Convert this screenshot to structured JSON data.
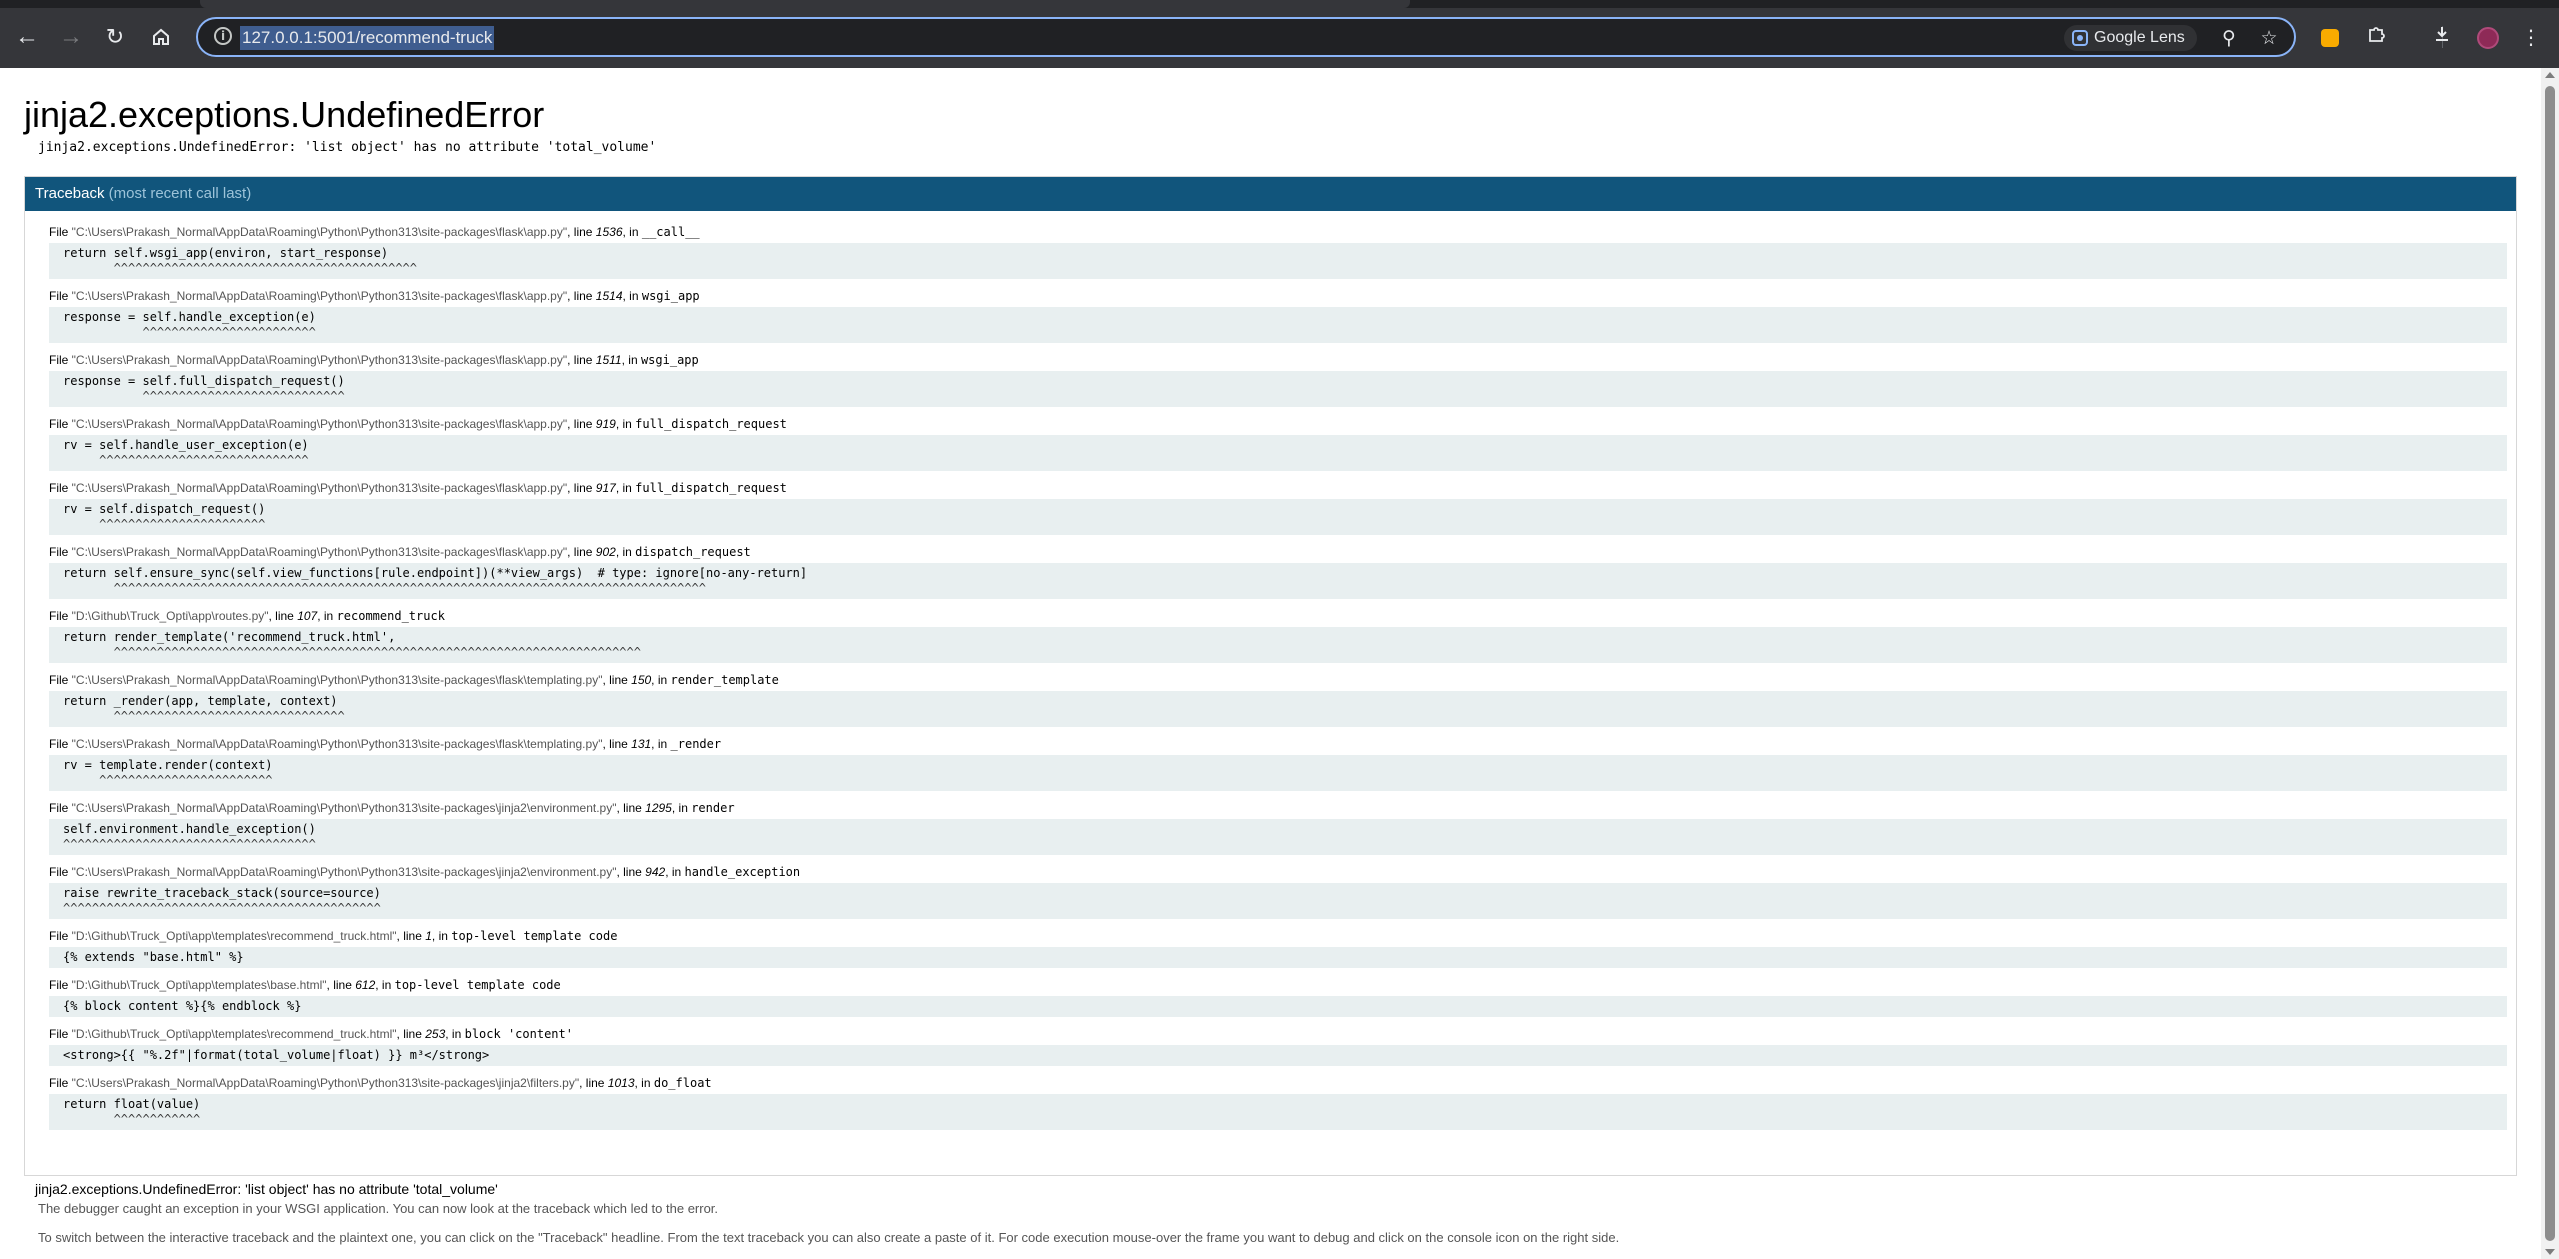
{
  "browser": {
    "url": "127.0.0.1:5001/recommend-truck",
    "lens_label": "Google Lens",
    "icons": [
      "back-icon",
      "forward-icon",
      "reload-icon",
      "home-icon",
      "info-icon",
      "google-lens-icon",
      "zoom-icon",
      "bookmark-star-icon",
      "extension-icon",
      "extensions-puzzle-icon",
      "downloads-icon",
      "profile-avatar",
      "more-menu-icon"
    ]
  },
  "error": {
    "title": "jinja2.exceptions.UndefinedError",
    "message": "jinja2.exceptions.UndefinedError: 'list object' has no attribute 'total_volume'"
  },
  "traceback": {
    "header": "Traceback",
    "header_sub": "(most recent call last)",
    "frames": [
      {
        "file": "\"C:\\Users\\Prakash_Normal\\AppData\\Roaming\\Python\\Python313\\site-packages\\flask\\app.py\"",
        "line": "1536",
        "func": "__call__",
        "code": "return self.wsgi_app(environ, start_response)",
        "caret": "       ^^^^^^^^^^^^^^^^^^^^^^^^^^^^^^^^^^^^^^^^^^"
      },
      {
        "file": "\"C:\\Users\\Prakash_Normal\\AppData\\Roaming\\Python\\Python313\\site-packages\\flask\\app.py\"",
        "line": "1514",
        "func": "wsgi_app",
        "code": "response = self.handle_exception(e)",
        "caret": "           ^^^^^^^^^^^^^^^^^^^^^^^^"
      },
      {
        "file": "\"C:\\Users\\Prakash_Normal\\AppData\\Roaming\\Python\\Python313\\site-packages\\flask\\app.py\"",
        "line": "1511",
        "func": "wsgi_app",
        "code": "response = self.full_dispatch_request()",
        "caret": "           ^^^^^^^^^^^^^^^^^^^^^^^^^^^^"
      },
      {
        "file": "\"C:\\Users\\Prakash_Normal\\AppData\\Roaming\\Python\\Python313\\site-packages\\flask\\app.py\"",
        "line": "919",
        "func": "full_dispatch_request",
        "code": "rv = self.handle_user_exception(e)",
        "caret": "     ^^^^^^^^^^^^^^^^^^^^^^^^^^^^^"
      },
      {
        "file": "\"C:\\Users\\Prakash_Normal\\AppData\\Roaming\\Python\\Python313\\site-packages\\flask\\app.py\"",
        "line": "917",
        "func": "full_dispatch_request",
        "code": "rv = self.dispatch_request()",
        "caret": "     ^^^^^^^^^^^^^^^^^^^^^^^"
      },
      {
        "file": "\"C:\\Users\\Prakash_Normal\\AppData\\Roaming\\Python\\Python313\\site-packages\\flask\\app.py\"",
        "line": "902",
        "func": "dispatch_request",
        "code": "return self.ensure_sync(self.view_functions[rule.endpoint])(**view_args)  # type: ignore[no-any-return]",
        "caret": "       ^^^^^^^^^^^^^^^^^^^^^^^^^^^^^^^^^^^^^^^^^^^^^^^^^^^^^^^^^^^^^^^^^^^^^^^^^^^^^^^^^^"
      },
      {
        "file": "\"D:\\Github\\Truck_Opti\\app\\routes.py\"",
        "line": "107",
        "func": "recommend_truck",
        "code": "return render_template('recommend_truck.html',",
        "caret": "       ^^^^^^^^^^^^^^^^^^^^^^^^^^^^^^^^^^^^^^^^^^^^^^^^^^^^^^^^^^^^^^^^^^^^^^^^^"
      },
      {
        "file": "\"C:\\Users\\Prakash_Normal\\AppData\\Roaming\\Python\\Python313\\site-packages\\flask\\templating.py\"",
        "line": "150",
        "func": "render_template",
        "code": "return _render(app, template, context)",
        "caret": "       ^^^^^^^^^^^^^^^^^^^^^^^^^^^^^^^^"
      },
      {
        "file": "\"C:\\Users\\Prakash_Normal\\AppData\\Roaming\\Python\\Python313\\site-packages\\flask\\templating.py\"",
        "line": "131",
        "func": "_render",
        "code": "rv = template.render(context)",
        "caret": "     ^^^^^^^^^^^^^^^^^^^^^^^^"
      },
      {
        "file": "\"C:\\Users\\Prakash_Normal\\AppData\\Roaming\\Python\\Python313\\site-packages\\jinja2\\environment.py\"",
        "line": "1295",
        "func": "render",
        "code": "self.environment.handle_exception()",
        "caret": "^^^^^^^^^^^^^^^^^^^^^^^^^^^^^^^^^^^"
      },
      {
        "file": "\"C:\\Users\\Prakash_Normal\\AppData\\Roaming\\Python\\Python313\\site-packages\\jinja2\\environment.py\"",
        "line": "942",
        "func": "handle_exception",
        "code": "raise rewrite_traceback_stack(source=source)",
        "caret": "^^^^^^^^^^^^^^^^^^^^^^^^^^^^^^^^^^^^^^^^^^^^"
      },
      {
        "file": "\"D:\\Github\\Truck_Opti\\app\\templates\\recommend_truck.html\"",
        "line": "1",
        "func": "top-level template code",
        "code": "{% extends \"base.html\" %}",
        "caret": ""
      },
      {
        "file": "\"D:\\Github\\Truck_Opti\\app\\templates\\base.html\"",
        "line": "612",
        "func": "top-level template code",
        "code": "{% block content %}{% endblock %}",
        "caret": ""
      },
      {
        "file": "\"D:\\Github\\Truck_Opti\\app\\templates\\recommend_truck.html\"",
        "line": "253",
        "func": "block 'content'",
        "code": "<strong>{{ \"%.2f\"|format(total_volume|float) }} m³</strong>",
        "caret": ""
      },
      {
        "file": "\"C:\\Users\\Prakash_Normal\\AppData\\Roaming\\Python\\Python313\\site-packages\\jinja2\\filters.py\"",
        "line": "1013",
        "func": "do_float",
        "code": "return float(value)",
        "caret": "       ^^^^^^^^^^^^"
      }
    ],
    "footer_error": "jinja2.exceptions.UndefinedError: 'list object' has no attribute 'total_volume'"
  },
  "notes": {
    "line1": "The debugger caught an exception in your WSGI application. You can now look at the traceback which led to the error.",
    "line2": "To switch between the interactive traceback and the plaintext one, you can click on the \"Traceback\" headline. From the text traceback you can also create a paste of it. For code execution mouse-over the frame you want to debug and click on the console icon on the right side."
  }
}
